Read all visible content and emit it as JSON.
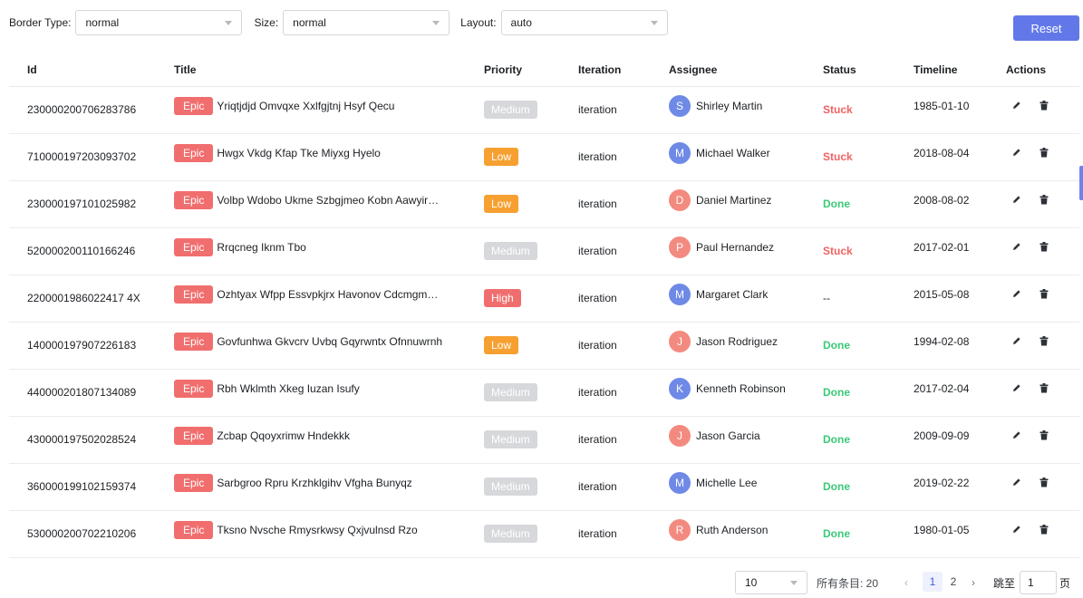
{
  "toolbar": {
    "border_type_label": "Border Type:",
    "border_type_value": "normal",
    "size_label": "Size:",
    "size_value": "normal",
    "layout_label": "Layout:",
    "layout_value": "auto",
    "reset_label": "Reset"
  },
  "table": {
    "headers": [
      "Id",
      "Title",
      "Priority",
      "Iteration",
      "Assignee",
      "Status",
      "Timeline",
      "Actions"
    ],
    "rows": [
      {
        "id": "230000200706283786",
        "tag": "Epic",
        "title": "Yriqtjdjd Omvqxe Xxlfgjtnj Hsyf Qecu",
        "priority": "Medium",
        "iteration": "iteration",
        "avatar": "S",
        "assignee": "Shirley Martin",
        "status": "Stuck",
        "timeline": "1985-01-10"
      },
      {
        "id": "710000197203093702",
        "tag": "Epic",
        "title": "Hwgx Vkdg Kfap Tke Miyxg Hyelo",
        "priority": "Low",
        "iteration": "iteration",
        "avatar": "M",
        "assignee": "Michael Walker",
        "status": "Stuck",
        "timeline": "2018-08-04"
      },
      {
        "id": "230000197101025982",
        "tag": "Epic",
        "title": "Volbp Wdobo Ukme Szbgjmeo Kobn Aawyir…",
        "priority": "Low",
        "iteration": "iteration",
        "avatar": "D",
        "assignee": "Daniel Martinez",
        "status": "Done",
        "timeline": "2008-08-02"
      },
      {
        "id": "520000200110166246",
        "tag": "Epic",
        "title": "Rrqcneg Iknm Tbo",
        "priority": "Medium",
        "iteration": "iteration",
        "avatar": "P",
        "assignee": "Paul Hernandez",
        "status": "Stuck",
        "timeline": "2017-02-01"
      },
      {
        "id": "2200001986022417 4X",
        "tag": "Epic",
        "title": "Ozhtyax Wfpp Essvpkjrx Havonov Cdcmgmg…",
        "priority": "High",
        "iteration": "iteration",
        "avatar": "M",
        "assignee": "Margaret Clark",
        "status": "--",
        "timeline": "2015-05-08"
      },
      {
        "id": "140000197907226183",
        "tag": "Epic",
        "title": "Govfunhwa Gkvcrv Uvbq Gqyrwntx Ofnnuwrnh",
        "priority": "Low",
        "iteration": "iteration",
        "avatar": "J",
        "assignee": "Jason Rodriguez",
        "status": "Done",
        "timeline": "1994-02-08"
      },
      {
        "id": "440000201807134089",
        "tag": "Epic",
        "title": "Rbh Wklmth Xkeg Iuzan Isufy",
        "priority": "Medium",
        "iteration": "iteration",
        "avatar": "K",
        "assignee": "Kenneth Robinson",
        "status": "Done",
        "timeline": "2017-02-04"
      },
      {
        "id": "430000197502028524",
        "tag": "Epic",
        "title": "Zcbap Qqoyxrimw Hndekkk",
        "priority": "Medium",
        "iteration": "iteration",
        "avatar": "J",
        "assignee": "Jason Garcia",
        "status": "Done",
        "timeline": "2009-09-09"
      },
      {
        "id": "360000199102159374",
        "tag": "Epic",
        "title": "Sarbgroo Rpru Krzhklgihv Vfgha Bunyqz",
        "priority": "Medium",
        "iteration": "iteration",
        "avatar": "M",
        "assignee": "Michelle Lee",
        "status": "Done",
        "timeline": "2019-02-22"
      },
      {
        "id": "530000200702210206",
        "tag": "Epic",
        "title": "Tksno Nvsche Rmysrkwsy Qxjvulnsd Rzo",
        "priority": "Medium",
        "iteration": "iteration",
        "avatar": "R",
        "assignee": "Ruth Anderson",
        "status": "Done",
        "timeline": "1980-01-05"
      }
    ]
  },
  "pagination": {
    "page_size": "10",
    "total_text": "所有条目: 20",
    "pages": [
      "1",
      "2"
    ],
    "current_page": "1",
    "jump_label": "跳至",
    "jump_value": "1",
    "page_suffix": "页"
  },
  "colors": {
    "accent": "#6378e8",
    "epic": "#f16e6e",
    "priority_medium": "#d6d8db",
    "priority_low": "#f6a031",
    "priority_high": "#f16e6e",
    "status_stuck": "#f06262",
    "status_done": "#3ac978",
    "avatar_blue": "#6f8ae6",
    "avatar_red": "#f38a80"
  }
}
